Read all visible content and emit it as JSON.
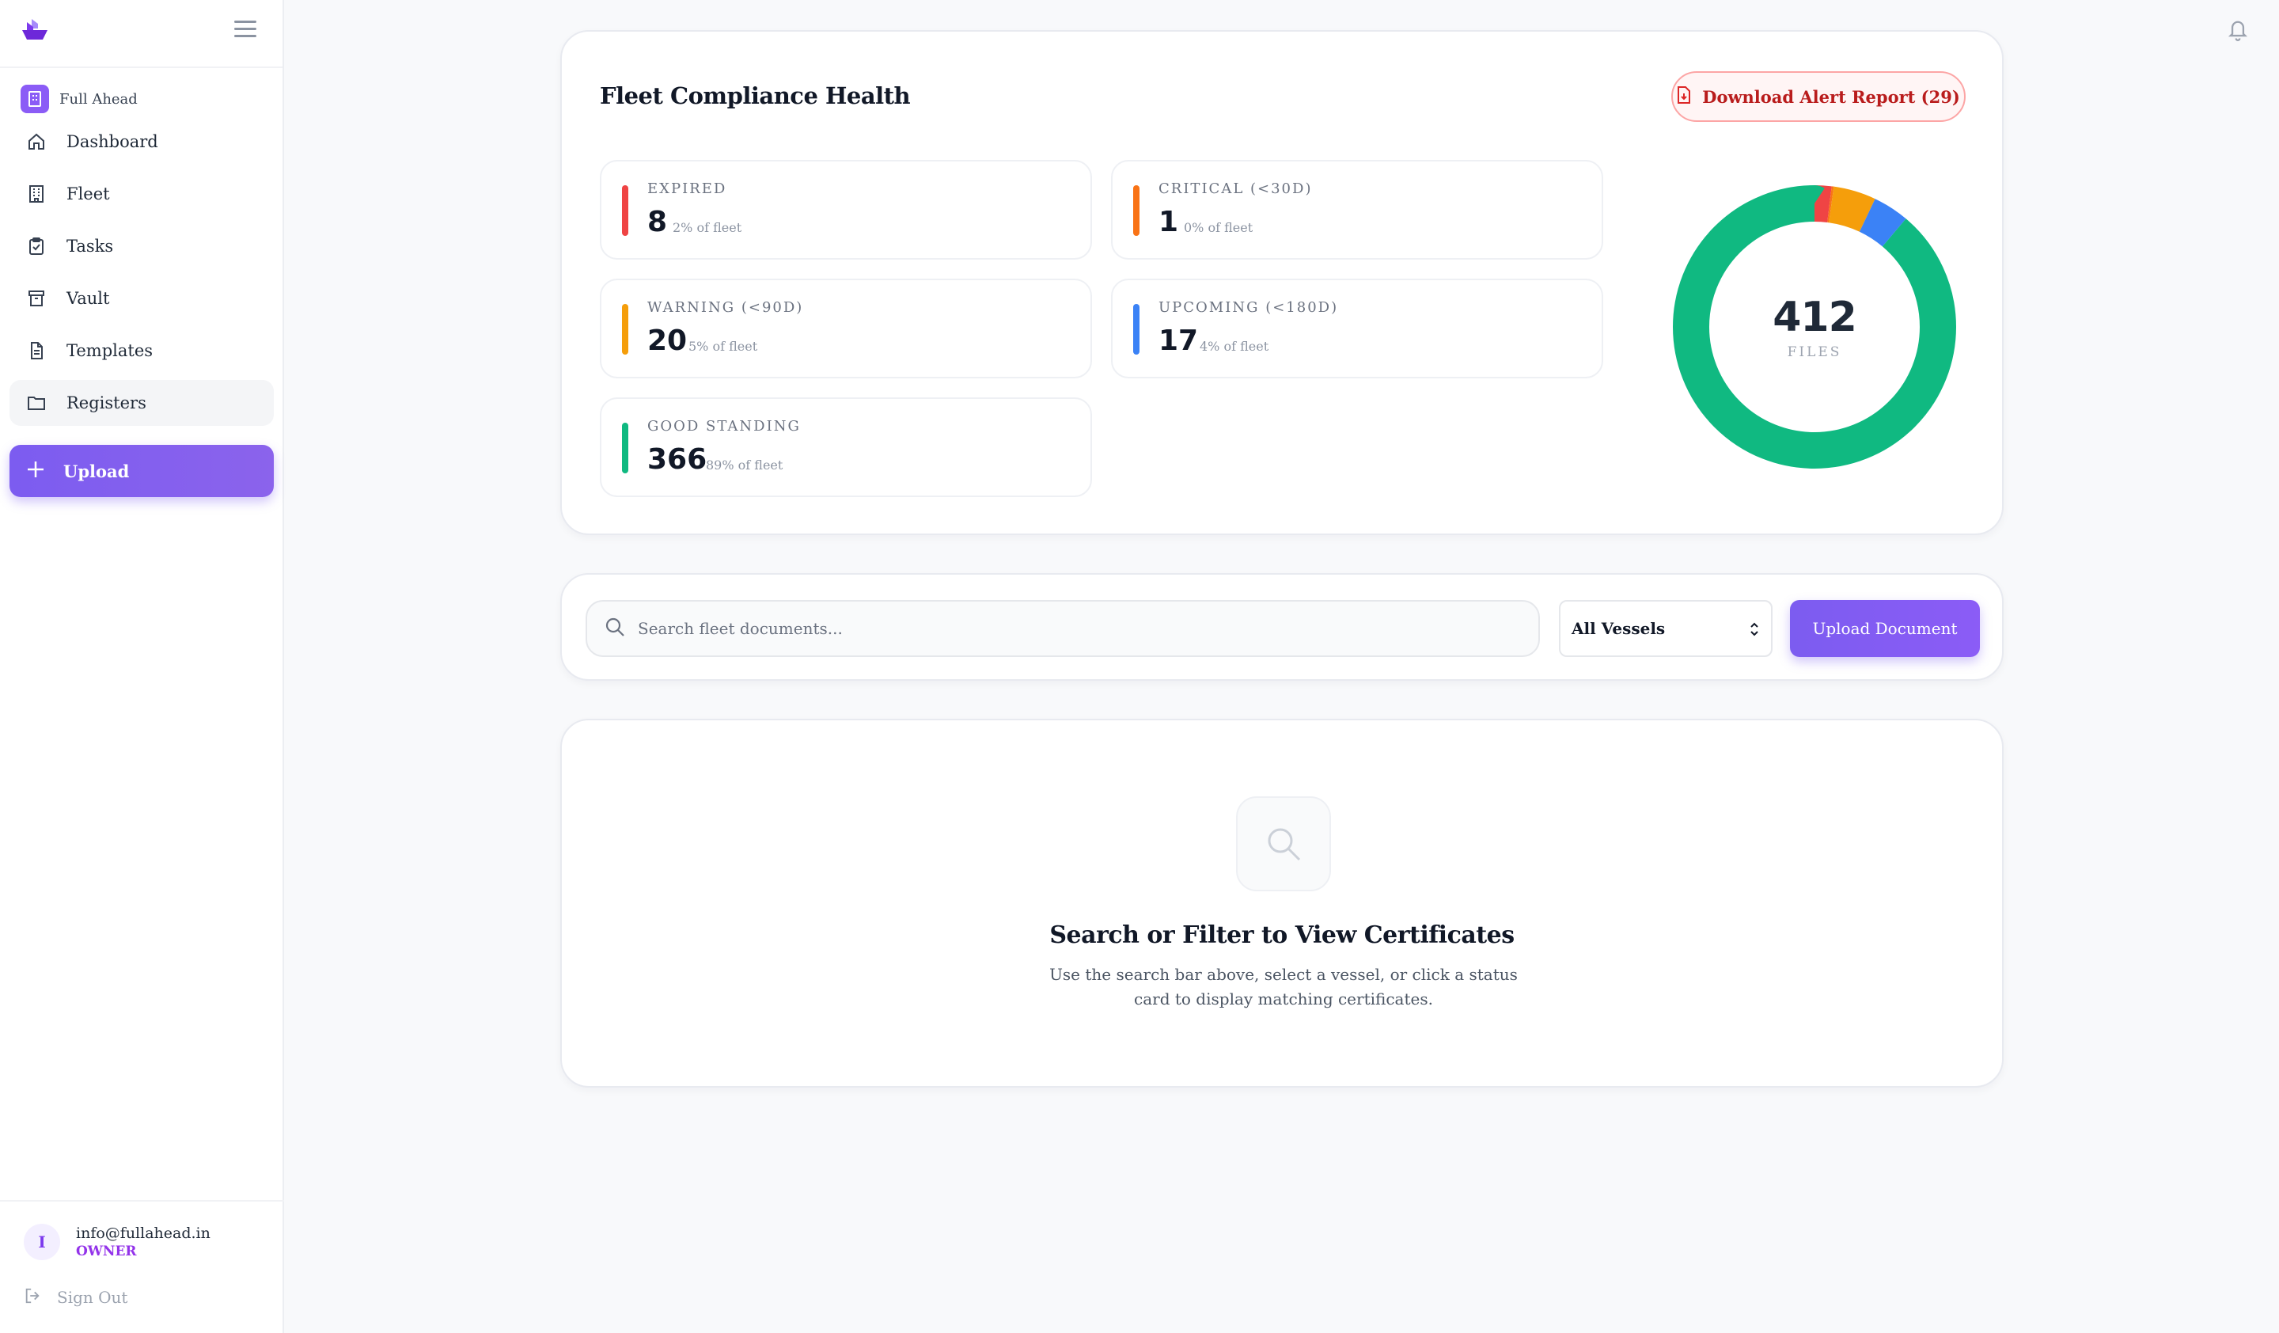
{
  "sidebar": {
    "org_name": "Full Ahead",
    "items": [
      {
        "label": "Dashboard",
        "icon": "home-icon"
      },
      {
        "label": "Fleet",
        "icon": "building-icon"
      },
      {
        "label": "Tasks",
        "icon": "clipboard-check-icon"
      },
      {
        "label": "Vault",
        "icon": "archive-icon"
      },
      {
        "label": "Templates",
        "icon": "file-text-icon"
      },
      {
        "label": "Registers",
        "icon": "folder-icon"
      }
    ],
    "upload_label": "Upload",
    "user": {
      "initial": "I",
      "email": "info@fullahead.in",
      "role": "OWNER"
    },
    "signout_label": "Sign Out"
  },
  "health": {
    "title": "Fleet Compliance Health",
    "alert_button": "Download Alert Report (29)",
    "stats": [
      {
        "caption": "EXPIRED",
        "value": "8",
        "pct": "2% of fleet",
        "color": "#ef4444"
      },
      {
        "caption": "CRITICAL (<30D)",
        "value": "1",
        "pct": "0% of fleet",
        "color": "#f97316"
      },
      {
        "caption": "WARNING (<90D)",
        "value": "20",
        "pct": "5% of fleet",
        "color": "#f59e0b"
      },
      {
        "caption": "UPCOMING (<180D)",
        "value": "17",
        "pct": "4% of fleet",
        "color": "#3b82f6"
      },
      {
        "caption": "GOOD STANDING",
        "value": "366",
        "pct": "89% of fleet",
        "color": "#10b981"
      }
    ],
    "donut": {
      "total": "412",
      "label": "FILES"
    }
  },
  "search": {
    "placeholder": "Search fleet documents...",
    "vessel_select": "All Vessels",
    "upload_button": "Upload Document"
  },
  "empty": {
    "title": "Search or Filter to View Certificates",
    "desc": "Use the search bar above, select a vessel, or click a status card to display matching certificates."
  },
  "colors": {
    "accent": "#7c5cf0",
    "expired": "#ef4444",
    "critical": "#f97316",
    "warning": "#f59e0b",
    "upcoming": "#3b82f6",
    "good": "#10b981"
  }
}
